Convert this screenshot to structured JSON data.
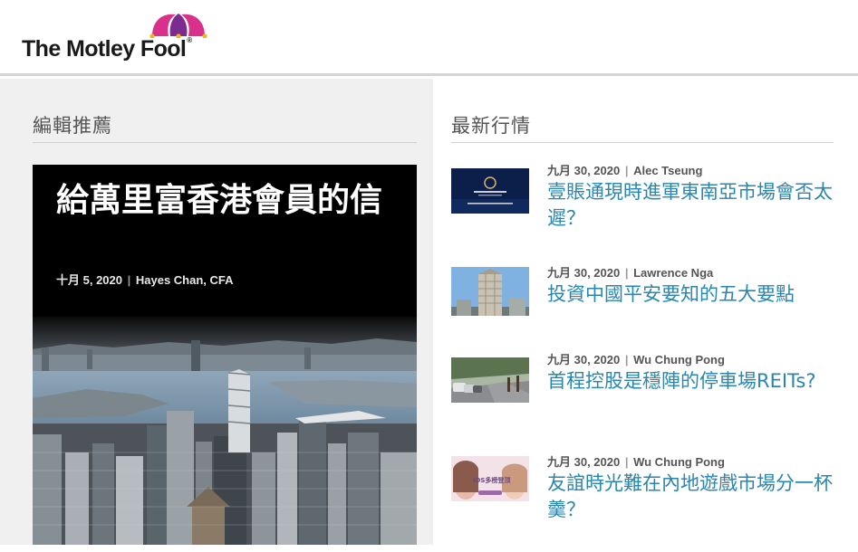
{
  "logo": {
    "text": "The Motley Fool",
    "reg": "®"
  },
  "editors_picks": {
    "heading": "編輯推薦",
    "feature": {
      "title": "給萬里富香港會員的信",
      "date": "十月 5, 2020",
      "author": "Hayes Chan, CFA"
    }
  },
  "latest": {
    "heading": "最新行情",
    "items": [
      {
        "date": "九月 30, 2020",
        "author": "Alec Tseung",
        "title": "壹賬通現時進軍東南亞市場會否太遲？",
        "thumb_icon": "building-graphic-thumbnail"
      },
      {
        "date": "九月 30, 2020",
        "author": "Lawrence Nga",
        "title": "投資中國平安要知的五大要點",
        "thumb_icon": "tower-photo-thumbnail"
      },
      {
        "date": "九月 30, 2020",
        "author": "Wu Chung Pong",
        "title": "首程控股是穩陣的停車場REITs?",
        "thumb_icon": "street-parking-thumbnail"
      },
      {
        "date": "九月 30, 2020",
        "author": "Wu Chung Pong",
        "title": "友誼時光難在內地遊戲市場分一杯羹？",
        "thumb_icon": "game-promo-thumbnail",
        "thumb_text": "iOS多榜登顶"
      }
    ]
  },
  "colors": {
    "link": "#2a86ae",
    "header_border": "#d4d4d4",
    "page_bg": "#f0f0f0"
  }
}
